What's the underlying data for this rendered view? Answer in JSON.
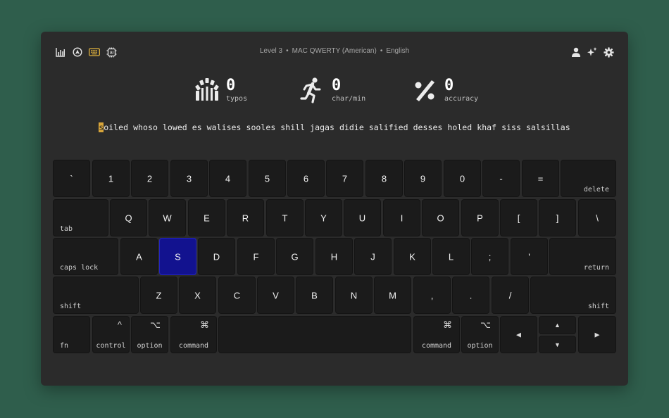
{
  "header": {
    "level": "Level 3",
    "layout": "MAC QWERTY (American)",
    "language": "English",
    "separator": "•",
    "left_icons": [
      "stats-icon",
      "compass-icon",
      "keyboard-icon",
      "ai-chip-icon"
    ],
    "right_icons": [
      "user-icon",
      "sparkles-icon",
      "gear-icon"
    ]
  },
  "stats": {
    "typos": {
      "value": "0",
      "label": "typos"
    },
    "speed": {
      "value": "0",
      "label": "char/min"
    },
    "accuracy": {
      "value": "0",
      "label": "accuracy"
    }
  },
  "prompt": {
    "cursor_char": "s",
    "rest": "oiled whoso lowed es walises sooles shill jagas didie salified desses holed khaf siss salsillas"
  },
  "keyboard": {
    "active_key": "S",
    "active_color": "#12128f",
    "keys": {
      "backtick": "`",
      "k1": "1",
      "k2": "2",
      "k3": "3",
      "k4": "4",
      "k5": "5",
      "k6": "6",
      "k7": "7",
      "k8": "8",
      "k9": "9",
      "k0": "0",
      "minus": "-",
      "equal": "=",
      "delete": "delete",
      "tab": "tab",
      "q": "Q",
      "w": "W",
      "e": "E",
      "r": "R",
      "t": "T",
      "y": "Y",
      "u": "U",
      "i": "I",
      "o": "O",
      "p": "P",
      "lbracket": "[",
      "rbracket": "]",
      "backslash": "\\",
      "caps": "caps lock",
      "a": "A",
      "s": "S",
      "d": "D",
      "f": "F",
      "g": "G",
      "h": "H",
      "j": "J",
      "k": "K",
      "l": "L",
      "semicolon": ";",
      "quote": "'",
      "return": "return",
      "lshift": "shift",
      "z": "Z",
      "x": "X",
      "c": "C",
      "v": "V",
      "b": "B",
      "n": "N",
      "m": "M",
      "comma": ",",
      "period": ".",
      "slash": "/",
      "rshift": "shift",
      "fn": "fn",
      "control": "control",
      "control_sym": "^",
      "loption": "option",
      "option_sym": "⌥",
      "lcommand": "command",
      "command_sym": "⌘",
      "rcommand": "command",
      "roption": "option",
      "left": "◀",
      "up": "▲",
      "down": "▼",
      "right": "▶"
    }
  }
}
